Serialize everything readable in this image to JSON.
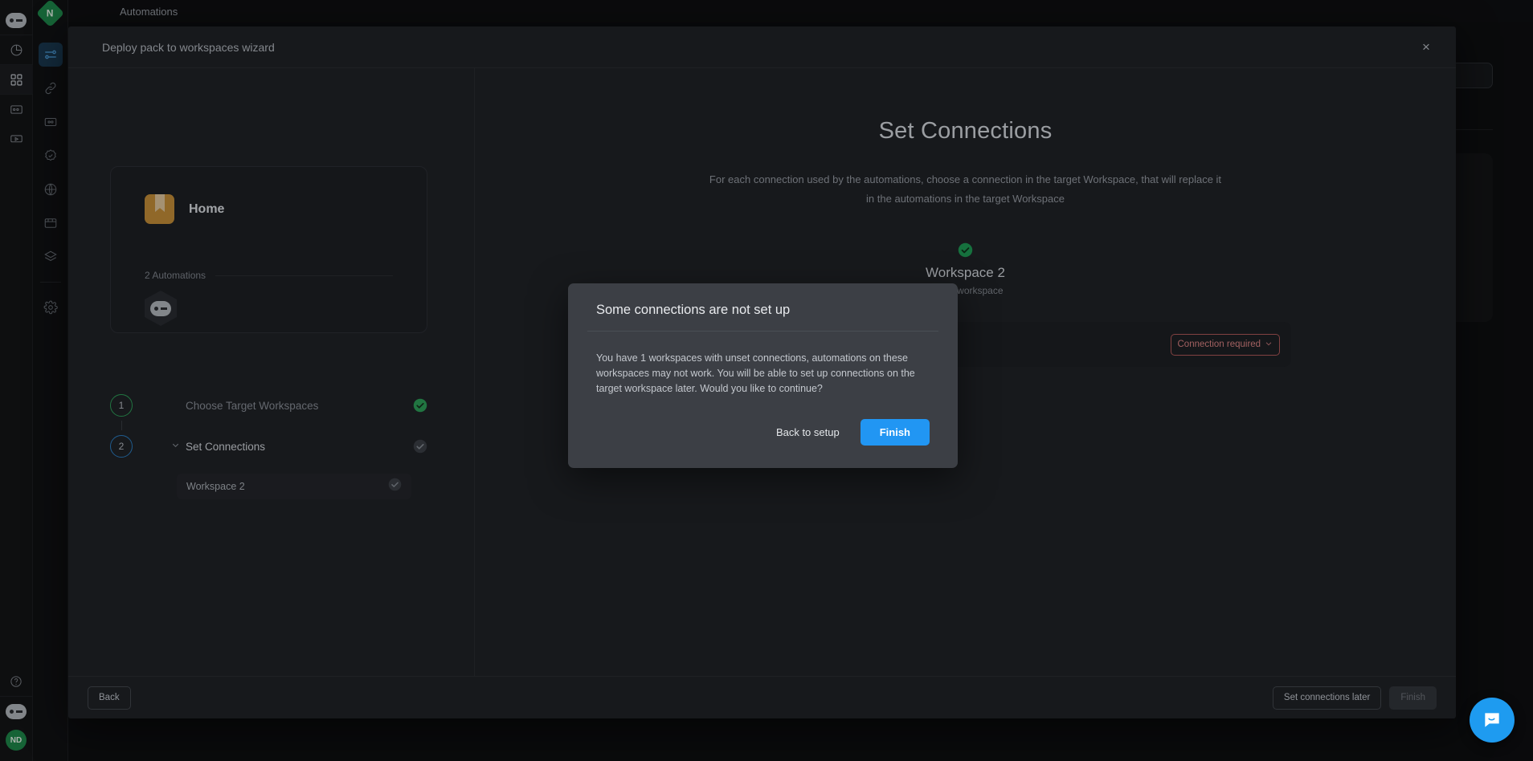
{
  "app": {
    "background_top_title": "Automations",
    "outer_rail": [
      {
        "name": "brand-robot-icon",
        "icon": "robot"
      },
      {
        "name": "analytics-icon",
        "icon": "pie-chart"
      },
      {
        "name": "apps-grid-icon",
        "icon": "grid",
        "active": true
      },
      {
        "name": "cards-icon",
        "icon": "card"
      },
      {
        "name": "media-icon",
        "icon": "media"
      }
    ],
    "outer_rail_bottom": [
      {
        "name": "help-icon",
        "icon": "question"
      },
      {
        "name": "account-robot-icon",
        "icon": "robot"
      },
      {
        "name": "user-avatar",
        "icon": "avatar",
        "initials": "ND"
      }
    ],
    "inner_rail": {
      "logo_letter": "N",
      "items": [
        {
          "name": "automations-icon",
          "icon": "automations",
          "active": true
        },
        {
          "name": "link-icon",
          "icon": "link",
          "active": false
        },
        {
          "name": "connections-icon",
          "icon": "connections",
          "active": false
        },
        {
          "name": "verified-icon",
          "icon": "verified",
          "active": false
        },
        {
          "name": "globe-icon",
          "icon": "globe",
          "active": false
        },
        {
          "name": "browser-icon",
          "icon": "browser",
          "active": false
        },
        {
          "name": "layers-icon",
          "icon": "layers",
          "active": false
        },
        {
          "name": "settings-icon",
          "icon": "gear",
          "active": false
        }
      ]
    }
  },
  "wizard": {
    "title": "Deploy pack to workspaces wizard",
    "close_label": "×",
    "pack": {
      "name": "Home",
      "automations_count_label": "2 Automations"
    },
    "steps": [
      {
        "number": "1",
        "label": "Choose Target Workspaces",
        "state": "complete",
        "ring_color": "#2fa35b",
        "check_color": "#2fa35b"
      },
      {
        "number": "2",
        "label": "Set Connections",
        "state": "current",
        "ring_color": "#2b7fc4",
        "check_color": "#3c4047",
        "caret": "⌄"
      }
    ],
    "sub_items": [
      {
        "label": "Workspace 2",
        "check_color": "#3c4047"
      }
    ],
    "panel": {
      "heading": "Set Connections",
      "description_line1": "For each connection used by the automations, choose a connection in the target Workspace, that will replace it",
      "description_line2": "in the automations in the target Workspace",
      "workspace_name": "Workspace 2",
      "workspace_role": "Target workspace",
      "connection_select_value": "Connection required",
      "connection_select_color": "#e08686"
    },
    "footer": {
      "back_label": "Back",
      "set_later_label": "Set connections later",
      "finish_label": "Finish",
      "finish_disabled": true
    }
  },
  "alert": {
    "title": "Some connections are not set up",
    "body": "You have 1 workspaces with unset connections, automations on these workspaces may not work. You will be able to set up connections on the target workspace later. Would you like to continue?",
    "secondary_label": "Back to setup",
    "primary_label": "Finish",
    "primary_color": "#2196f3"
  },
  "chat": {
    "name": "chat-launcher",
    "icon": "chat-bubble"
  }
}
